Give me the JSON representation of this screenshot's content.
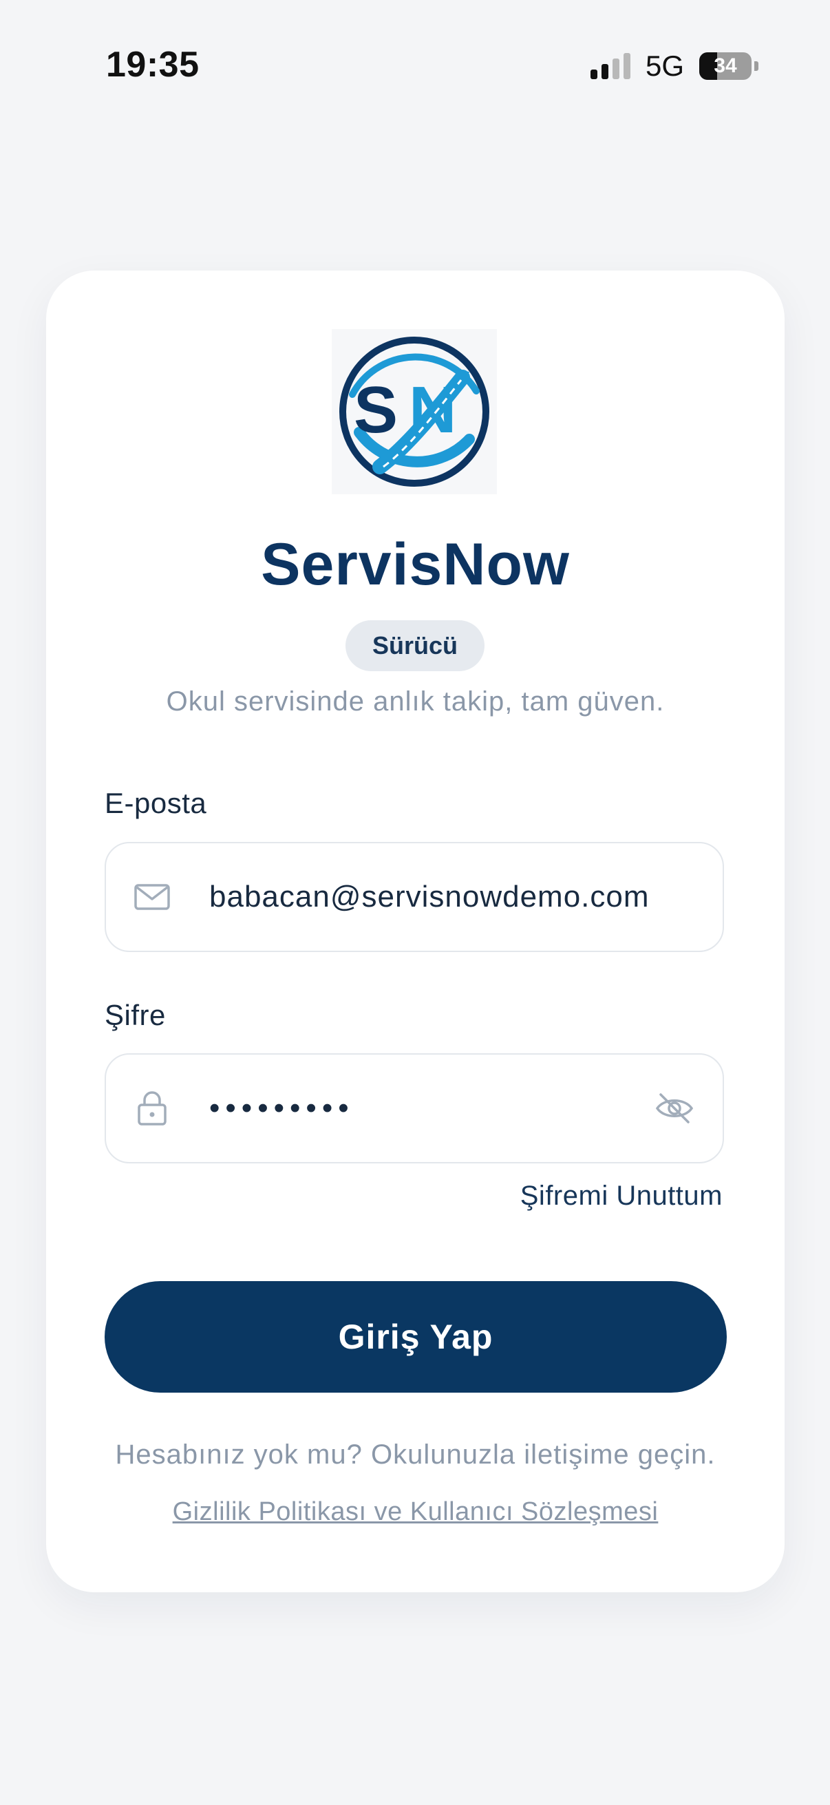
{
  "status_bar": {
    "time": "19:35",
    "network": "5G",
    "battery_level": "34",
    "battery_fraction": 0.34,
    "signal_bars_active": 2,
    "signal_bars_total": 4
  },
  "app": {
    "name": "ServisNow",
    "logo_icon": "servisnow-logo-icon",
    "role_badge": "Sürücü",
    "tagline": "Okul servisinde anlık takip, tam güven."
  },
  "form": {
    "email": {
      "label": "E-posta",
      "value": "babacan@servisnowdemo.com",
      "icon": "mail-icon"
    },
    "password": {
      "label": "Şifre",
      "masked_value": "•••••••••",
      "icon": "lock-icon",
      "toggle_icon": "eye-off-icon"
    },
    "forgot_password": "Şifremi Unuttum",
    "submit_label": "Giriş Yap"
  },
  "footer": {
    "no_account": "Hesabınız yok mu? Okulunuzla iletişime geçin.",
    "privacy": "Gizlilik Politikası ve Kullanıcı Sözleşmesi"
  },
  "colors": {
    "primary": "#0a3762",
    "brand_light_blue": "#1e9ad6",
    "muted_text": "#8a97a8",
    "background": "#f4f5f7"
  }
}
